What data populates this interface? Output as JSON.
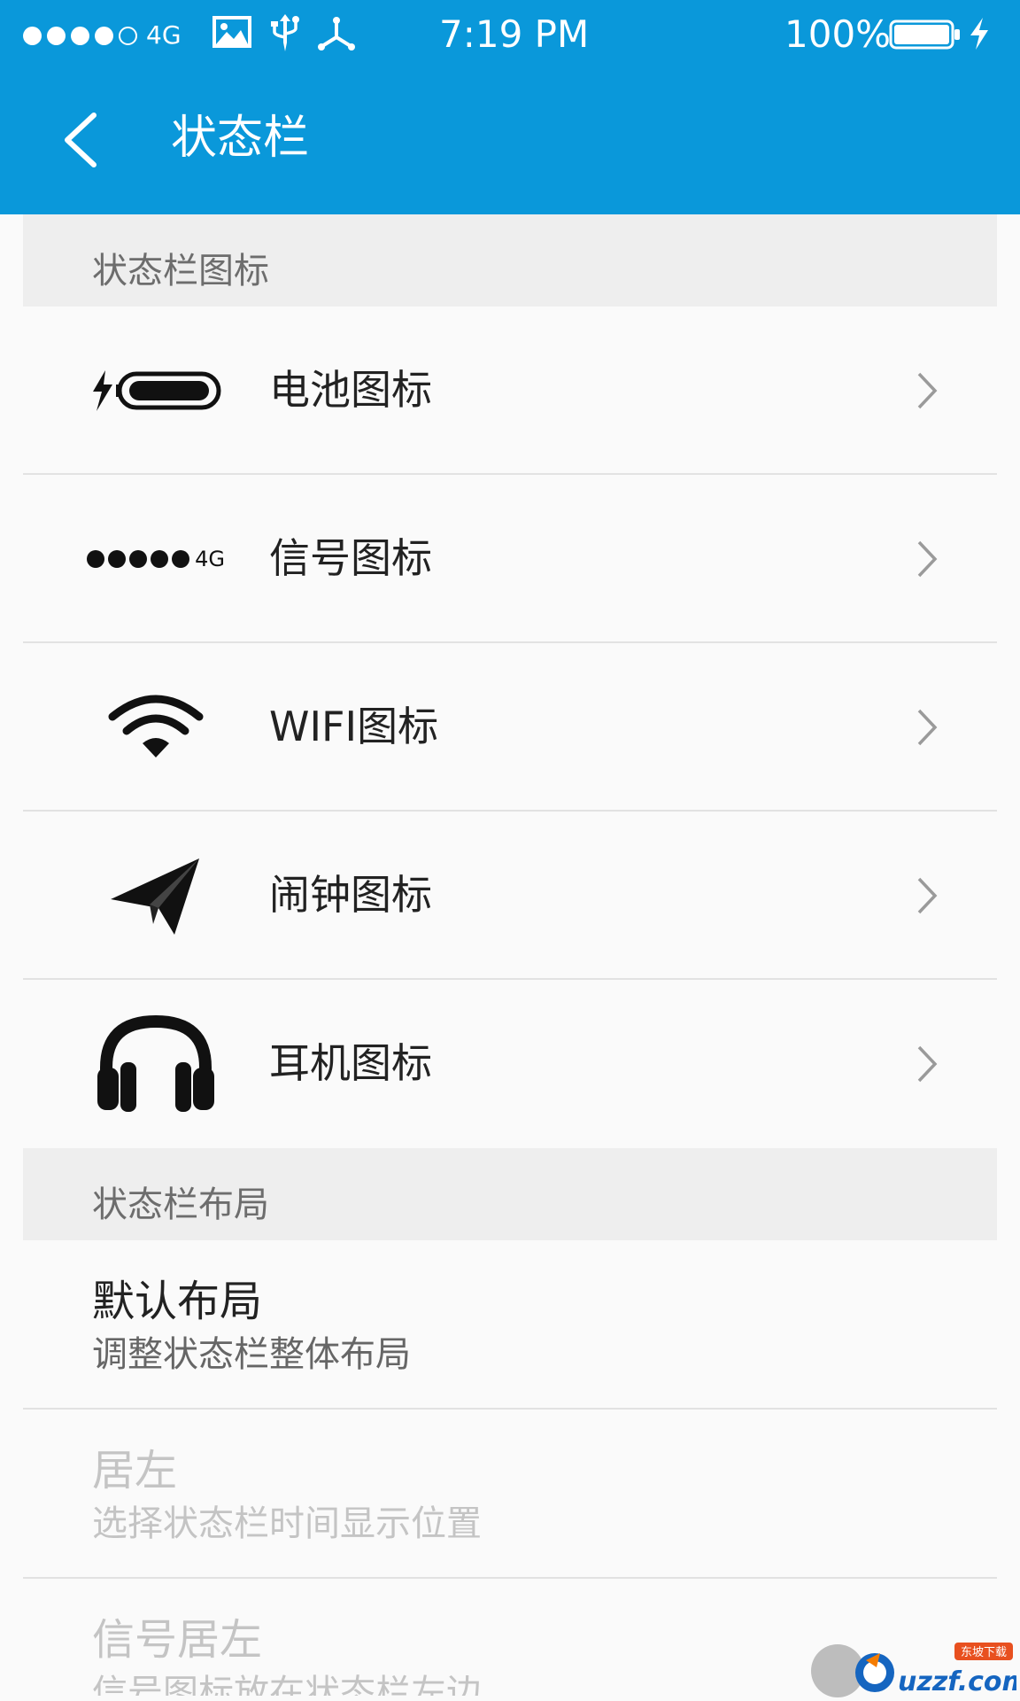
{
  "status_bar": {
    "network": "4G",
    "time": "7:19 PM",
    "battery_percent": "100%",
    "battery_level": 1.0,
    "signal_level": 4,
    "signal_max": 5,
    "icons": [
      "image-icon",
      "usb-icon",
      "usb-tethering-icon",
      "charging-icon"
    ]
  },
  "app_bar": {
    "title": "状态栏",
    "back_icon": "chevron-left-icon"
  },
  "sections": [
    {
      "header": "状态栏图标",
      "items": [
        {
          "label": "电池图标",
          "icon": "battery-icon"
        },
        {
          "label": "信号图标",
          "icon": "signal-icon",
          "icon_text": "4G"
        },
        {
          "label": "WIFI图标",
          "icon": "wifi-icon"
        },
        {
          "label": "闹钟图标",
          "icon": "paper-plane-icon"
        },
        {
          "label": "耳机图标",
          "icon": "headphones-icon"
        }
      ]
    },
    {
      "header": "状态栏布局",
      "settings": [
        {
          "title": "默认布局",
          "subtitle": "调整状态栏整体布局",
          "enabled": true
        },
        {
          "title": "居左",
          "subtitle": "选择状态栏时间显示位置",
          "enabled": false
        },
        {
          "title": "信号居左",
          "subtitle": "信号图标放在状态栏左边",
          "enabled": false
        }
      ]
    }
  ],
  "watermark": {
    "text": "uzzf.com",
    "badge": "东坡下载"
  },
  "colors": {
    "header_bg": "#0a98da",
    "list_bg": "#fafafa",
    "section_bg": "#eeeeee",
    "primary_text": "#222222",
    "secondary_text": "#666666",
    "disabled_text": "#c4c4c4"
  }
}
